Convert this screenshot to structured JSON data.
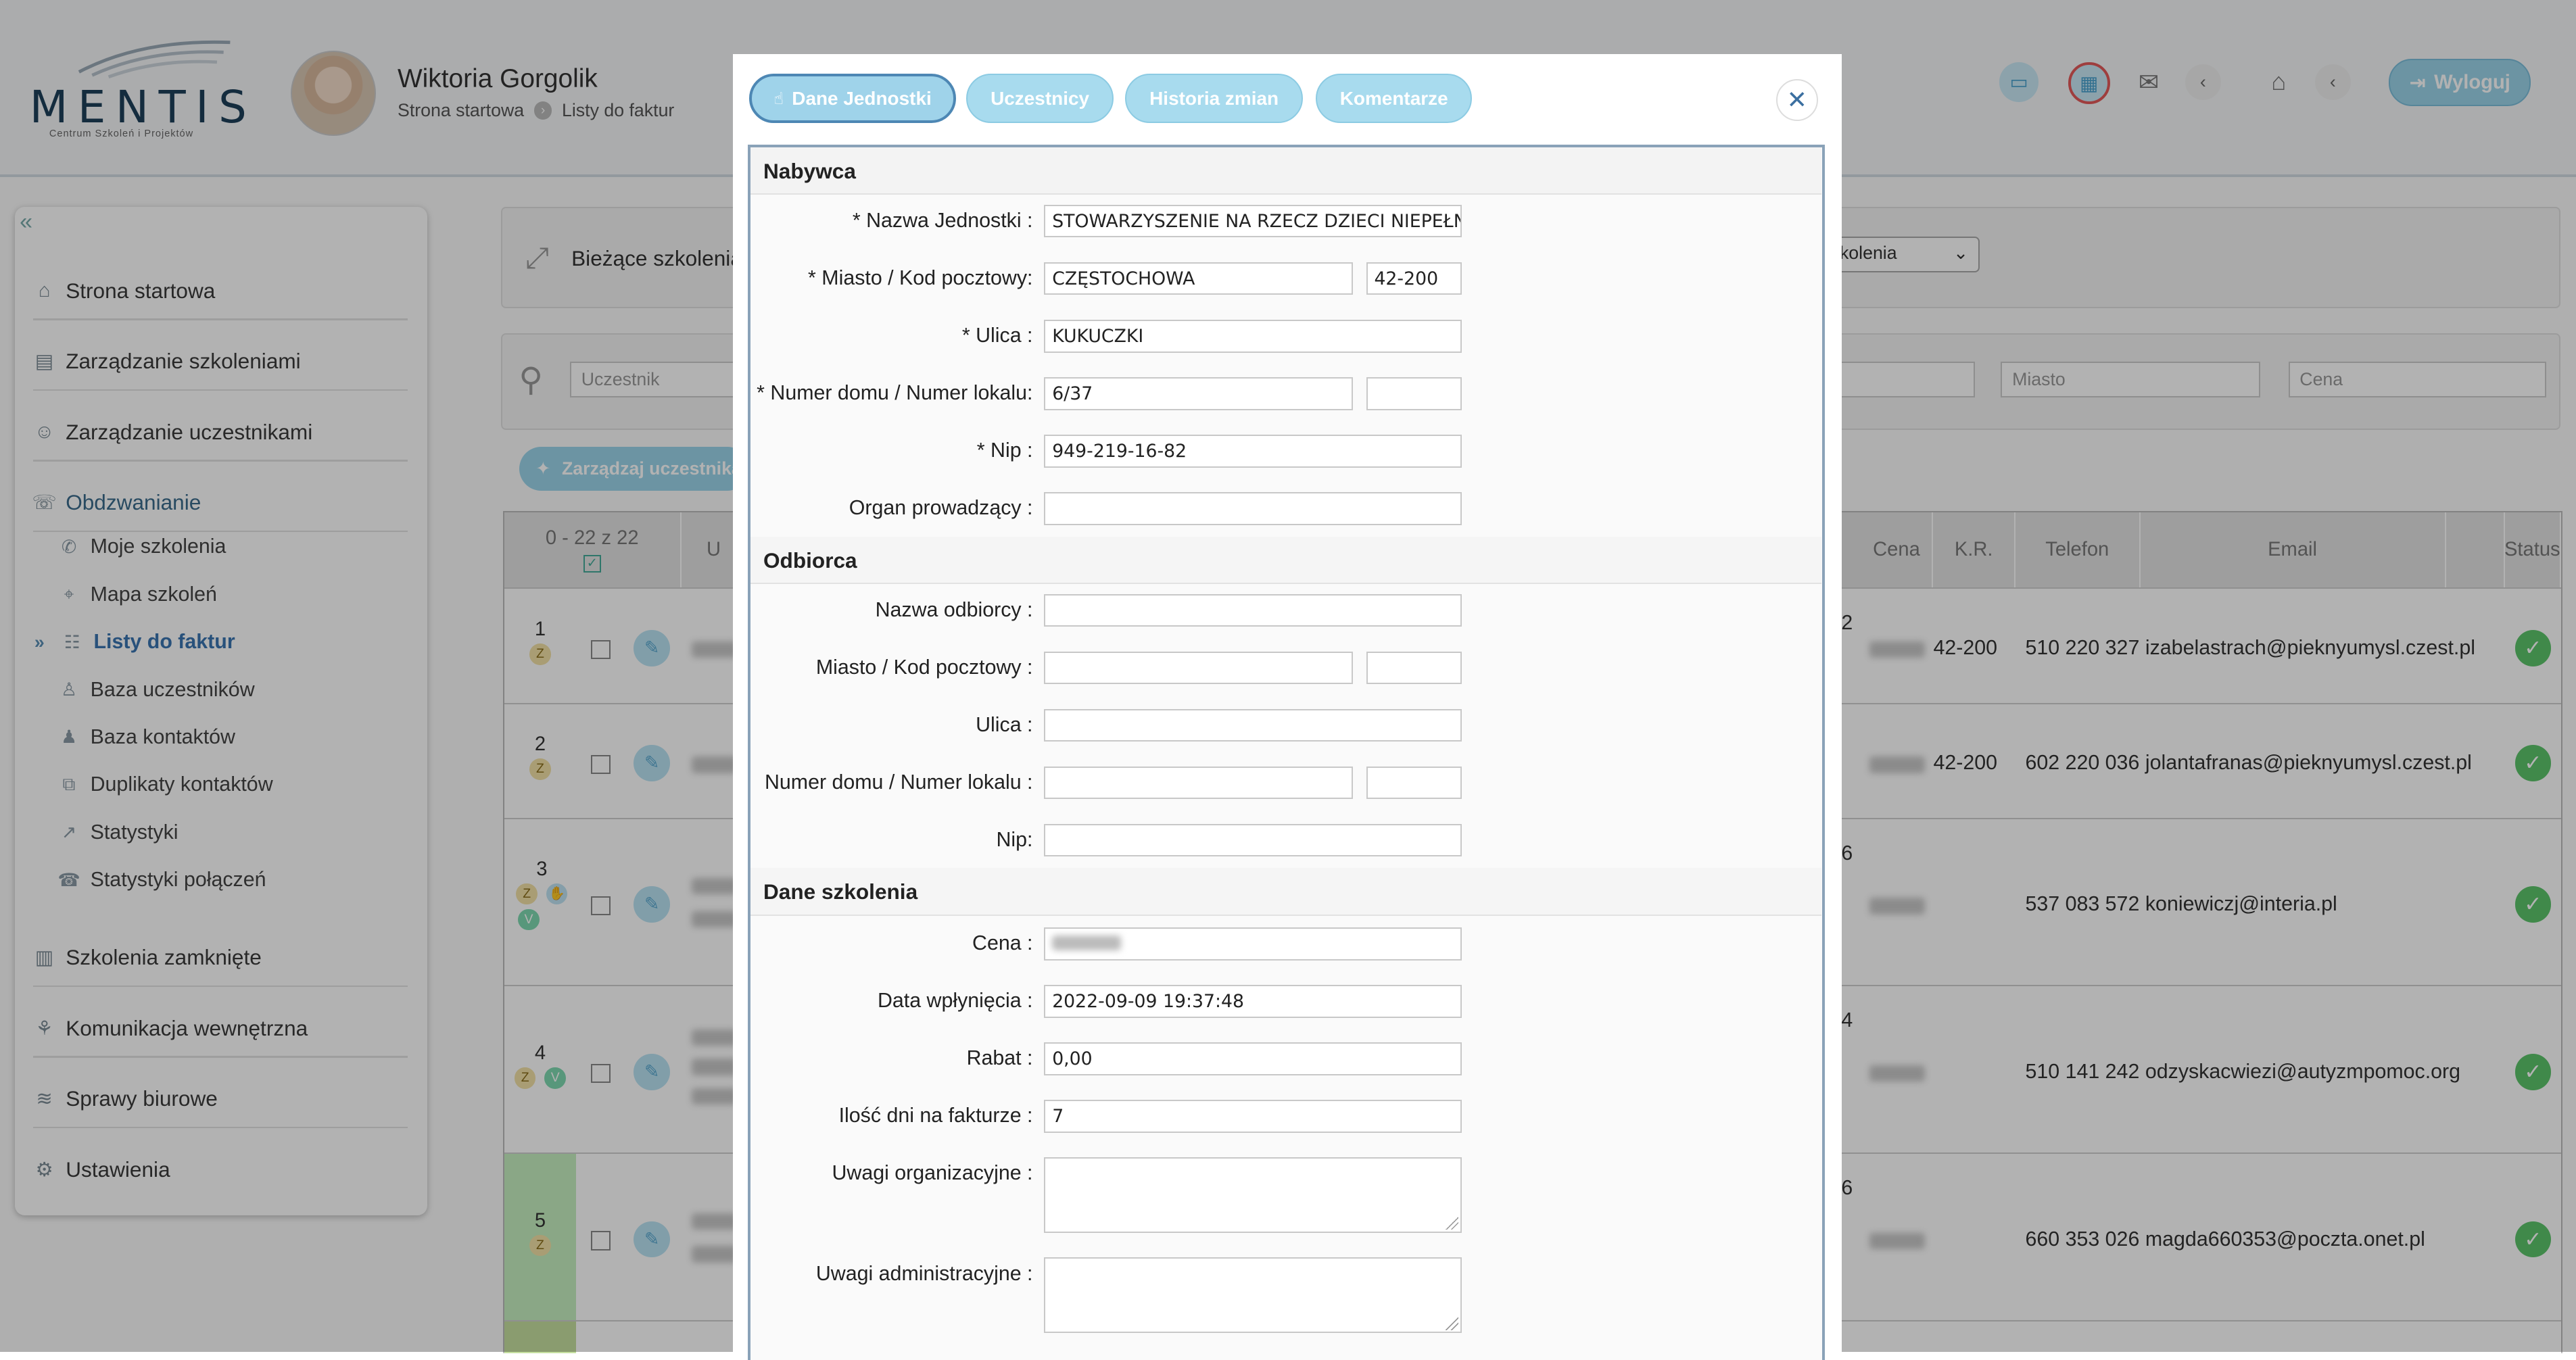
{
  "header": {
    "logo_name": "MENTIS",
    "logo_tagline": "Centrum Szkoleń i Projektów",
    "user_name": "Wiktoria Gorgolik",
    "breadcrumb": [
      "Strona startowa",
      "Listy do faktur"
    ],
    "logout_label": "Wyloguj"
  },
  "sidebar": {
    "items": [
      {
        "label": "Strona startowa",
        "icon": "home-icon"
      },
      {
        "label": "Zarządzanie szkoleniami",
        "icon": "presentation-icon"
      },
      {
        "label": "Zarządzanie uczestnikami",
        "icon": "users-icon"
      },
      {
        "label": "Obdzwanianie",
        "icon": "phone-book-icon"
      },
      {
        "label": "Szkolenia zamknięte",
        "icon": "archive-icon"
      },
      {
        "label": "Komunikacja wewnętrzna",
        "icon": "network-icon"
      },
      {
        "label": "Sprawy biurowe",
        "icon": "layers-icon"
      },
      {
        "label": "Ustawienia",
        "icon": "gear-icon"
      }
    ],
    "sub_items": [
      {
        "label": "Moje szkolenia",
        "icon": "phone-icon"
      },
      {
        "label": "Mapa szkoleń",
        "icon": "map-icon"
      },
      {
        "label": "Listy do faktur",
        "icon": "list-icon"
      },
      {
        "label": "Baza uczestników",
        "icon": "person-icon"
      },
      {
        "label": "Baza kontaktów",
        "icon": "contacts-icon"
      },
      {
        "label": "Duplikaty kontaktów",
        "icon": "duplicate-icon"
      },
      {
        "label": "Statystyki",
        "icon": "chart-icon"
      },
      {
        "label": "Statystyki połączeń",
        "icon": "call-stats-icon"
      }
    ]
  },
  "main": {
    "current_label": "Bieżące szkolenia:",
    "current_select": "kolenia",
    "filters": {
      "participant": "Uczestnik",
      "city": "Miasto",
      "price": "Cena"
    },
    "manage_button": "Zarządzaj uczestnika",
    "table": {
      "range_label": "0 - 22 z 22",
      "headers": [
        "U",
        "Cena",
        "K.R.",
        "Telefon",
        "Email",
        "Status"
      ],
      "rows": [
        {
          "num": "1",
          "badges": [
            "Z"
          ],
          "frag": "2",
          "kr": "42-200",
          "phone": "510 220 327",
          "email": "izabelastrach@pieknyumysl.czest.pl"
        },
        {
          "num": "2",
          "badges": [
            "Z"
          ],
          "frag": "",
          "kr": "42-200",
          "phone": "602 220 036",
          "email": "jolantafranas@pieknyumysl.czest.pl"
        },
        {
          "num": "3",
          "badges": [
            "Z",
            "H",
            "V"
          ],
          "frag": "6",
          "kr": "",
          "phone": "537 083 572",
          "email": "koniewiczj@interia.pl"
        },
        {
          "num": "4",
          "badges": [
            "Z",
            "V"
          ],
          "frag": "4",
          "kr": "",
          "phone": "510 141 242",
          "email": "odzyskacwiezi@autyzmpomoc.org"
        },
        {
          "num": "5",
          "badges": [
            "Z"
          ],
          "frag": "6",
          "kr": "",
          "phone": "660 353 026",
          "email": "magda660353@poczta.onet.pl"
        }
      ]
    }
  },
  "modal": {
    "tabs": [
      "Dane Jednostki",
      "Uczestnicy",
      "Historia zmian",
      "Komentarze"
    ],
    "sections": {
      "buyer": "Nabywca",
      "recipient": "Odbiorca",
      "training": "Dane szkolenia"
    },
    "buyer": {
      "name_label": "* Nazwa Jednostki :",
      "name_value": "STOWARZYSZENIE NA RZECZ DZIECI NIEPEŁNOSPRAWNYCH",
      "city_label": "* Miasto / Kod pocztowy:",
      "city_value": "CZĘSTOCHOWA",
      "zip_value": "42-200",
      "street_label": "* Ulica :",
      "street_value": "KUKUCZKI",
      "house_label": "* Numer domu / Numer lokalu:",
      "house_value": "6/37",
      "flat_value": "",
      "nip_label": "* Nip :",
      "nip_value": "949-219-16-82",
      "organ_label": "Organ prowadzący :",
      "organ_value": ""
    },
    "recipient": {
      "name_label": "Nazwa odbiorcy :",
      "city_label": "Miasto / Kod pocztowy :",
      "street_label": "Ulica :",
      "house_label": "Numer domu / Numer lokalu :",
      "nip_label": "Nip:"
    },
    "training": {
      "price_label": "Cena :",
      "date_label": "Data wpłynięcia :",
      "date_value": "2022-09-09 19:37:48",
      "discount_label": "Rabat :",
      "discount_value": "0,00",
      "days_label": "Ilość dni na fakturze :",
      "days_value": "7",
      "org_notes_label": "Uwagi organizacyjne :",
      "admin_notes_label": "Uwagi administracyjne :"
    }
  },
  "colors": {
    "accent": "#9fd3ea",
    "active_tab_border": "#4d87b4",
    "status_ok": "#5cc46b",
    "row_highlight": "#c6f0c0"
  }
}
